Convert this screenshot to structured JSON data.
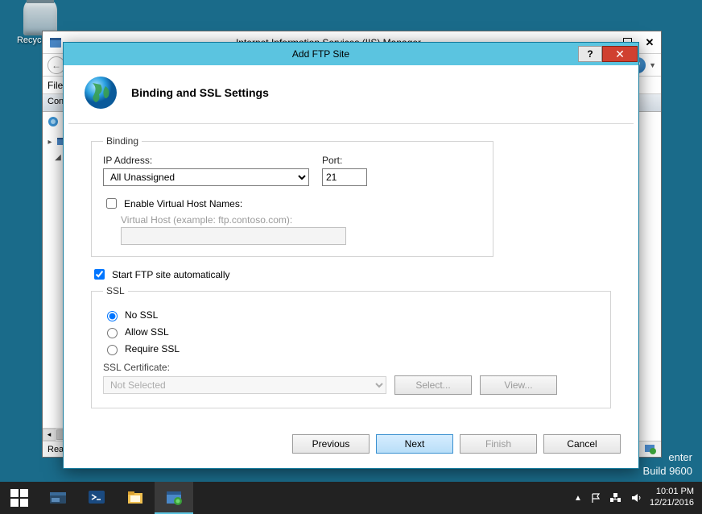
{
  "desktop": {
    "recycle_bin_label": "Recycle Bin"
  },
  "iis": {
    "title": "Internet Information Services (IIS) Manager",
    "menu": {
      "file": "File"
    },
    "panel_header": "Connections",
    "status": "Ready"
  },
  "dialog": {
    "title": "Add FTP Site",
    "header": "Binding and SSL Settings",
    "binding": {
      "legend": "Binding",
      "ip_label": "IP Address:",
      "ip_value": "All Unassigned",
      "port_label": "Port:",
      "port_value": "21",
      "vhost_checkbox": "Enable Virtual Host Names:",
      "vhost_hint": "Virtual Host (example: ftp.contoso.com):",
      "vhost_value": ""
    },
    "autostart_label": "Start FTP site automatically",
    "ssl": {
      "legend": "SSL",
      "no_ssl": "No SSL",
      "allow_ssl": "Allow SSL",
      "require_ssl": "Require SSL",
      "cert_label": "SSL Certificate:",
      "cert_value": "Not Selected",
      "select_btn": "Select...",
      "view_btn": "View..."
    },
    "buttons": {
      "previous": "Previous",
      "next": "Next",
      "finish": "Finish",
      "cancel": "Cancel"
    }
  },
  "watermark": {
    "line1": "enter",
    "line2": "Build 9600"
  },
  "tray": {
    "time": "10:01 PM",
    "date": "12/21/2016"
  }
}
